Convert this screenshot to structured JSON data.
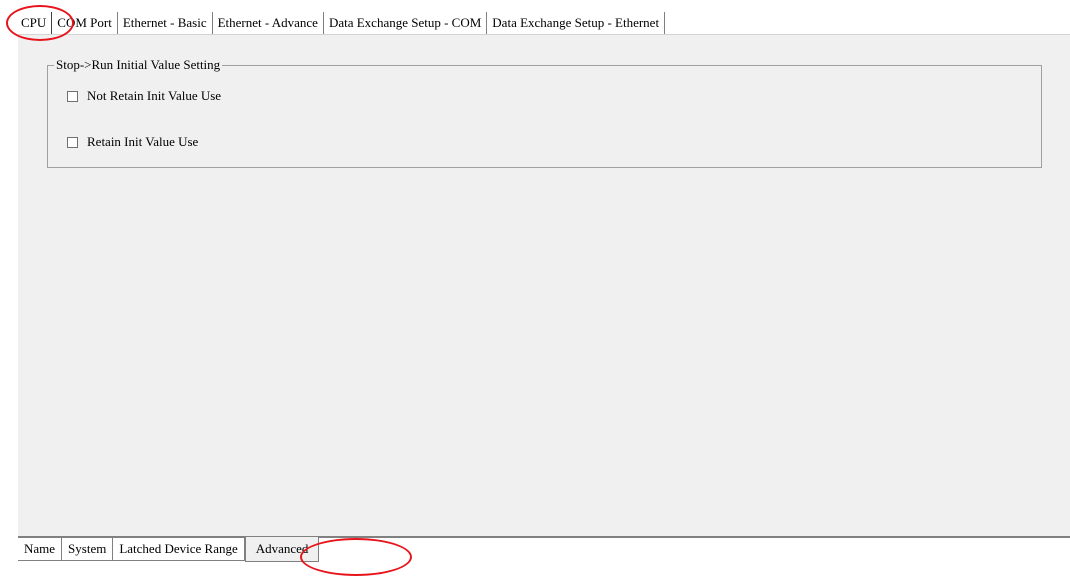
{
  "top_tabs": [
    {
      "label": "CPU",
      "active": true
    },
    {
      "label": "COM Port",
      "active": false
    },
    {
      "label": "Ethernet - Basic",
      "active": false
    },
    {
      "label": "Ethernet - Advance",
      "active": false
    },
    {
      "label": "Data Exchange Setup - COM",
      "active": false
    },
    {
      "label": "Data Exchange Setup - Ethernet",
      "active": false
    }
  ],
  "group": {
    "title": "Stop->Run Initial Value Setting",
    "options": [
      {
        "label": "Not Retain Init Value Use",
        "checked": false
      },
      {
        "label": "Retain Init Value Use",
        "checked": false
      }
    ]
  },
  "bottom_tabs": [
    {
      "label": "Name",
      "active": false
    },
    {
      "label": "System",
      "active": false
    },
    {
      "label": "Latched Device Range",
      "active": false
    },
    {
      "label": "Advanced",
      "active": true
    }
  ],
  "annotation_color": "#e8141c"
}
